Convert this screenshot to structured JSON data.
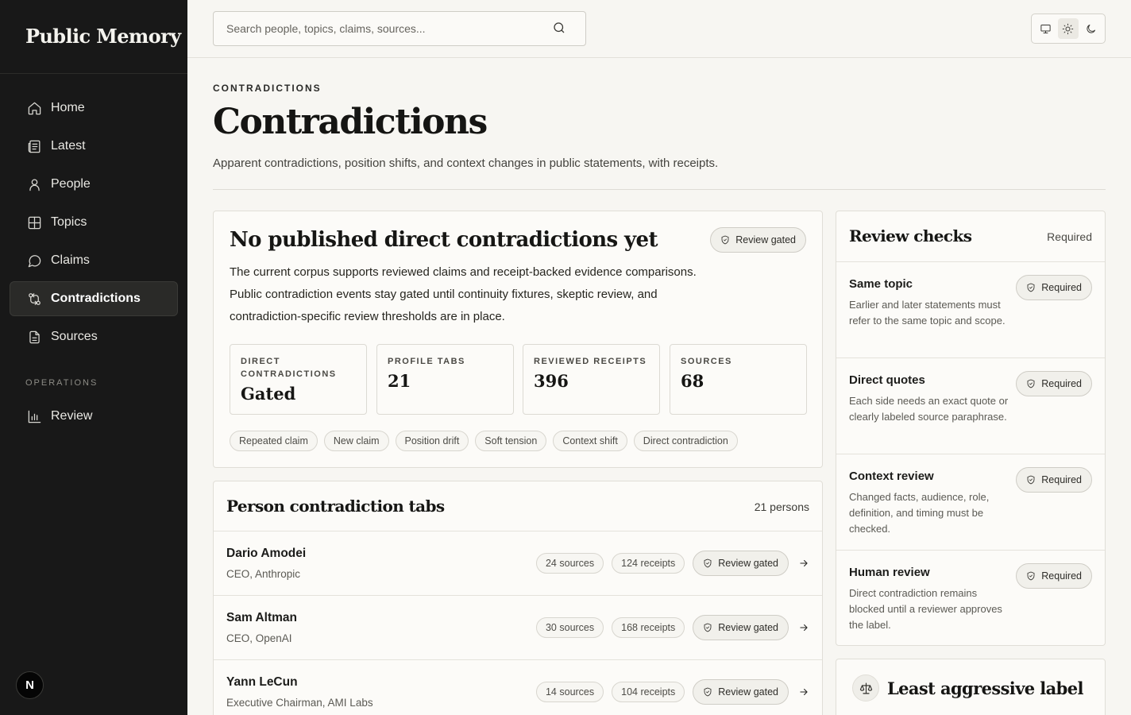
{
  "brand": "Public Memory",
  "nav": {
    "items": [
      {
        "label": "Home",
        "icon": "home-icon"
      },
      {
        "label": "Latest",
        "icon": "newspaper-icon"
      },
      {
        "label": "People",
        "icon": "user-icon"
      },
      {
        "label": "Topics",
        "icon": "grid-icon"
      },
      {
        "label": "Claims",
        "icon": "speech-bubble-icon"
      },
      {
        "label": "Contradictions",
        "icon": "git-compare-icon",
        "active": true
      },
      {
        "label": "Sources",
        "icon": "document-icon"
      }
    ],
    "section_label": "OPERATIONS",
    "ops_items": [
      {
        "label": "Review",
        "icon": "bar-chart-icon"
      }
    ]
  },
  "avatar_initial": "N",
  "search": {
    "placeholder": "Search people, topics, claims, sources..."
  },
  "theme": {
    "options": [
      "monitor-icon",
      "sun-icon",
      "moon-icon"
    ],
    "active": "sun-icon"
  },
  "header": {
    "eyebrow": "CONTRADICTIONS",
    "title": "Contradictions",
    "description": "Apparent contradictions, position shifts, and context changes in public statements, with receipts."
  },
  "status_card": {
    "title": "No published direct contradictions yet",
    "badge": "Review gated",
    "body": "The current corpus supports reviewed claims and receipt-backed evidence comparisons. Public contradiction events stay gated until continuity fixtures, skeptic review, and contradiction-specific review thresholds are in place.",
    "stats": [
      {
        "label": "DIRECT CONTRADICTIONS",
        "value": "Gated"
      },
      {
        "label": "PROFILE TABS",
        "value": "21"
      },
      {
        "label": "REVIEWED RECEIPTS",
        "value": "396"
      },
      {
        "label": "SOURCES",
        "value": "68"
      }
    ],
    "tags": [
      "Repeated claim",
      "New claim",
      "Position drift",
      "Soft tension",
      "Context shift",
      "Direct contradiction"
    ]
  },
  "person_tabs": {
    "title": "Person contradiction tabs",
    "count": "21 persons",
    "people": [
      {
        "name": "Dario Amodei",
        "role": "CEO, Anthropic",
        "sources": "24 sources",
        "receipts": "124 receipts",
        "status": "Review gated"
      },
      {
        "name": "Sam Altman",
        "role": "CEO, OpenAI",
        "sources": "30 sources",
        "receipts": "168 receipts",
        "status": "Review gated"
      },
      {
        "name": "Yann LeCun",
        "role": "Executive Chairman, AMI Labs",
        "sources": "14 sources",
        "receipts": "104 receipts",
        "status": "Review gated"
      }
    ]
  },
  "review_checks": {
    "title": "Review checks",
    "label": "Required",
    "items": [
      {
        "title": "Same topic",
        "desc": "Earlier and later statements must refer to the same topic and scope.",
        "badge": "Required"
      },
      {
        "title": "Direct quotes",
        "desc": "Each side needs an exact quote or clearly labeled source paraphrase.",
        "badge": "Required"
      },
      {
        "title": "Context review",
        "desc": "Changed facts, audience, role, definition, and timing must be checked.",
        "badge": "Required"
      },
      {
        "title": "Human review",
        "desc": "Direct contradiction remains blocked until a reviewer approves the label.",
        "badge": "Required"
      }
    ]
  },
  "label_card": {
    "title": "Least aggressive label",
    "icon": "scale-icon"
  }
}
